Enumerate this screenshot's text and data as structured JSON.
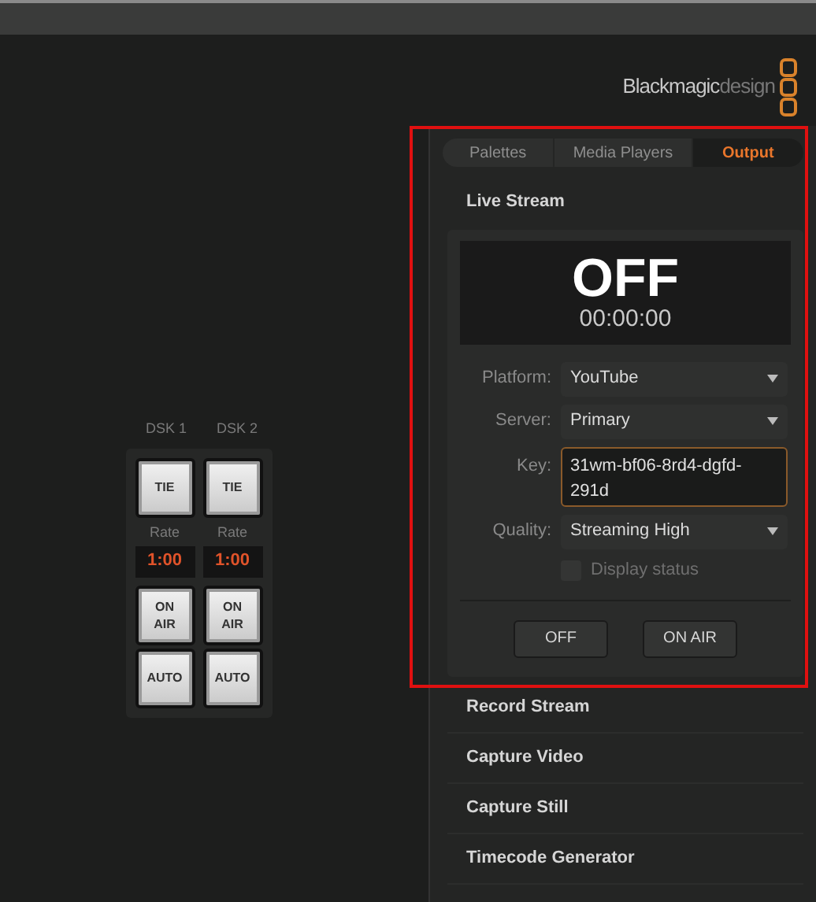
{
  "logo": {
    "brand": "Blackmagic",
    "suffix": "design"
  },
  "dsk": {
    "columns": [
      {
        "label": "DSK 1",
        "tie": "TIE",
        "rate_label": "Rate",
        "rate": "1:00",
        "on_air": "ON AIR",
        "auto": "AUTO"
      },
      {
        "label": "DSK 2",
        "tie": "TIE",
        "rate_label": "Rate",
        "rate": "1:00",
        "on_air": "ON AIR",
        "auto": "AUTO"
      }
    ]
  },
  "tabs": [
    {
      "label": "Palettes",
      "selected": false
    },
    {
      "label": "Media Players",
      "selected": false
    },
    {
      "label": "Output",
      "selected": true
    }
  ],
  "live_stream": {
    "title": "Live Stream",
    "status": "OFF",
    "timer": "00:00:00",
    "fields": [
      {
        "kind": "select",
        "label": "Platform:",
        "value": "YouTube"
      },
      {
        "kind": "select",
        "label": "Server:",
        "value": "Primary"
      },
      {
        "kind": "input",
        "label": "Key:",
        "value": "31wm-bf06-8rd4-dgfd-291d"
      },
      {
        "kind": "select",
        "label": "Quality:",
        "value": "Streaming High"
      },
      {
        "kind": "checkbox",
        "label": "Display status",
        "checked": false
      }
    ],
    "buttons": [
      "OFF",
      "ON AIR"
    ]
  },
  "sections": [
    "Record Stream",
    "Capture Video",
    "Capture Still",
    "Timecode Generator"
  ]
}
